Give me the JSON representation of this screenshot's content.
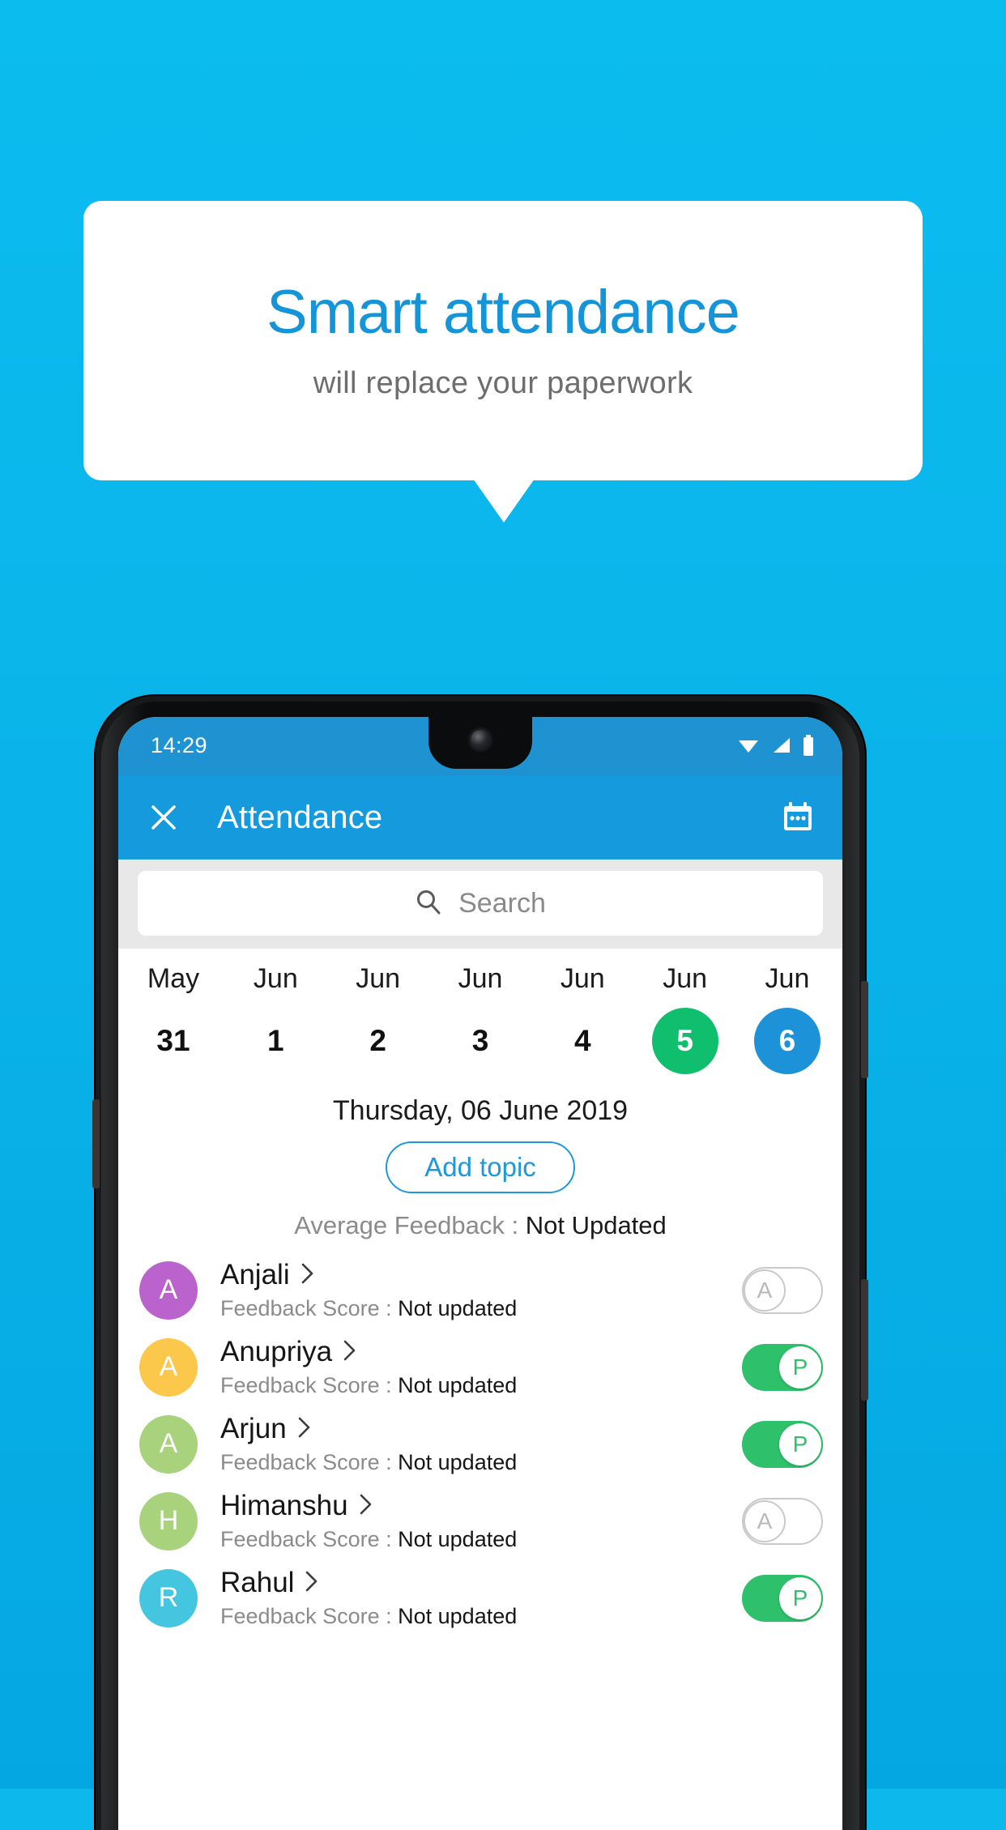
{
  "promo": {
    "title": "Smart attendance",
    "subtitle": "will replace your paperwork",
    "title_color": "#1595d8",
    "background_color": "#0cb8ec"
  },
  "phone": {
    "statusbar": {
      "time": "14:29",
      "icons": [
        "wifi-icon",
        "cellular-signal-icon",
        "battery-icon"
      ]
    },
    "appbar": {
      "close_label": "close-icon",
      "title": "Attendance",
      "calendar_label": "calendar-icon",
      "background_color": "#169ade"
    },
    "search": {
      "placeholder": "Search",
      "icon": "search-icon"
    },
    "dates": [
      {
        "month": "May",
        "day": "31",
        "state": "normal"
      },
      {
        "month": "Jun",
        "day": "1",
        "state": "normal"
      },
      {
        "month": "Jun",
        "day": "2",
        "state": "normal"
      },
      {
        "month": "Jun",
        "day": "3",
        "state": "normal"
      },
      {
        "month": "Jun",
        "day": "4",
        "state": "normal"
      },
      {
        "month": "Jun",
        "day": "5",
        "state": "green"
      },
      {
        "month": "Jun",
        "day": "6",
        "state": "blue"
      }
    ],
    "day_title": "Thursday, 06 June 2019",
    "add_topic_label": "Add topic",
    "average_feedback": {
      "label": "Average Feedback : ",
      "value": "Not Updated"
    },
    "students": [
      {
        "name": "Anjali",
        "initial": "A",
        "avatar_color": "#bb63cc",
        "score_label": "Feedback Score : ",
        "score_value": "Not updated",
        "attendance": "A",
        "attendance_state": "absent"
      },
      {
        "name": "Anupriya",
        "initial": "A",
        "avatar_color": "#fbc84b",
        "score_label": "Feedback Score : ",
        "score_value": "Not updated",
        "attendance": "P",
        "attendance_state": "present"
      },
      {
        "name": "Arjun",
        "initial": "A",
        "avatar_color": "#a8d37c",
        "score_label": "Feedback Score : ",
        "score_value": "Not updated",
        "attendance": "P",
        "attendance_state": "present"
      },
      {
        "name": "Himanshu",
        "initial": "H",
        "avatar_color": "#a8d37c",
        "score_label": "Feedback Score : ",
        "score_value": "Not updated",
        "attendance": "A",
        "attendance_state": "absent"
      },
      {
        "name": "Rahul",
        "initial": "R",
        "avatar_color": "#45c6e0",
        "score_label": "Feedback Score : ",
        "score_value": "Not updated",
        "attendance": "P",
        "attendance_state": "present"
      }
    ]
  }
}
